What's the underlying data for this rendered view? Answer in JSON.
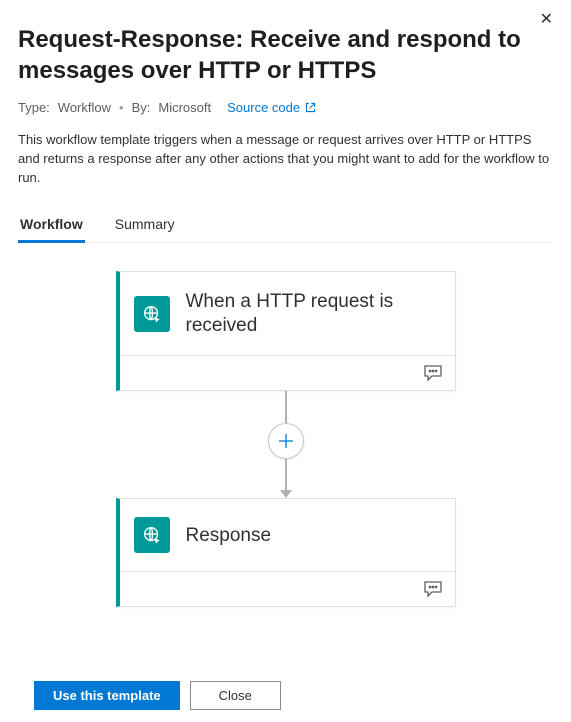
{
  "header": {
    "title": "Request-Response: Receive and respond to messages over HTTP or HTTPS"
  },
  "meta": {
    "type_label": "Type:",
    "type_value": "Workflow",
    "by_label": "By:",
    "by_value": "Microsoft",
    "source_link": "Source code"
  },
  "description": "This workflow template triggers when a message or request arrives over HTTP or HTTPS and returns a response after any other actions that you might want to add for the workflow to run.",
  "tabs": {
    "workflow": "Workflow",
    "summary": "Summary"
  },
  "nodes": {
    "trigger": {
      "title": "When a HTTP request is received"
    },
    "response": {
      "title": "Response"
    }
  },
  "footer": {
    "use_template": "Use this template",
    "close": "Close"
  }
}
